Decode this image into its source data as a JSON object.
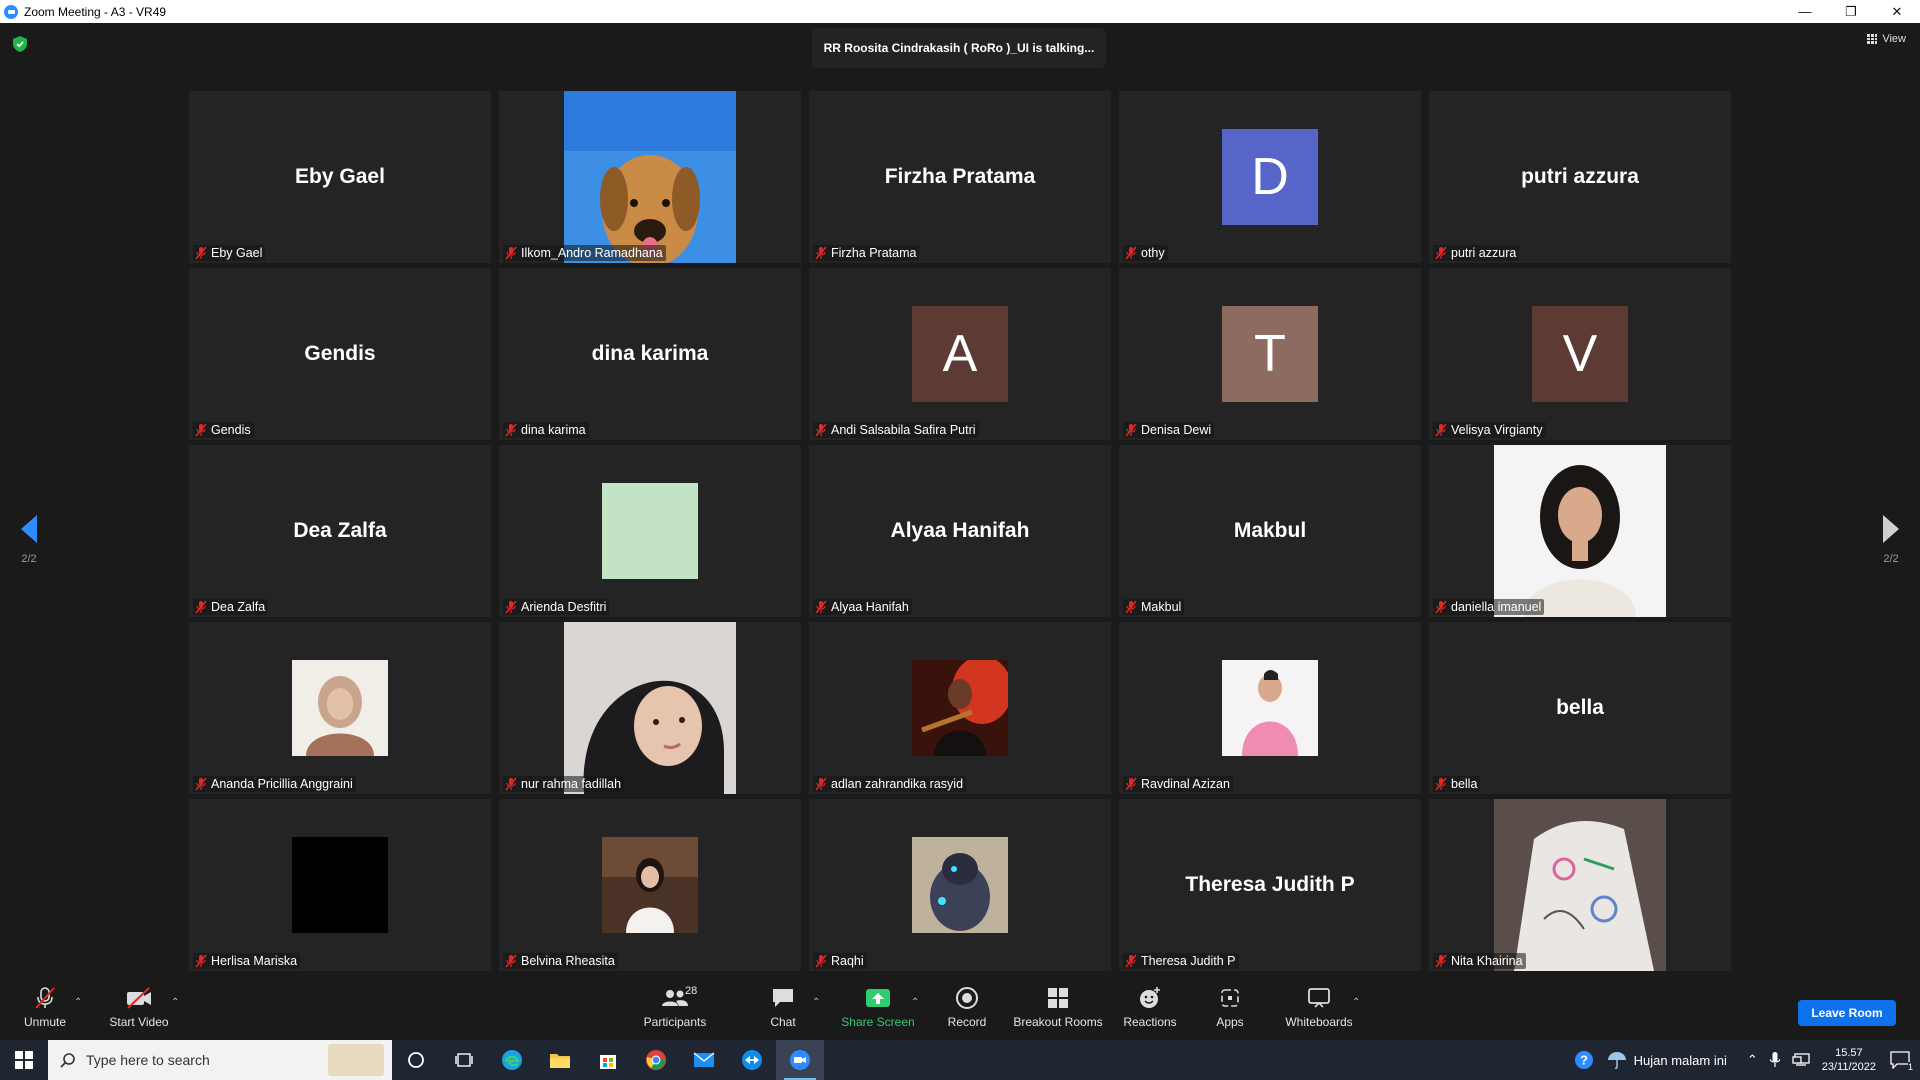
{
  "window": {
    "title": "Zoom Meeting - A3 - VR49",
    "controls": [
      "—",
      "❐",
      "✕"
    ]
  },
  "meeting": {
    "talking_indicator": "RR Roosita Cindrakasih ( RoRo )_UI is talking...",
    "view_label": "View",
    "page_left": "2/2",
    "page_right": "2/2"
  },
  "tiles": [
    {
      "name": "Eby Gael",
      "display": "Eby Gael",
      "type": "name"
    },
    {
      "name": "Ilkom_Andro Ramadhana",
      "type": "photo",
      "photo": "dog-photo"
    },
    {
      "name": "Firzha Pratama",
      "display": "Firzha Pratama",
      "type": "name"
    },
    {
      "name": "othy",
      "type": "avatar",
      "letter": "D",
      "color": "#5865c8"
    },
    {
      "name": "putri azzura",
      "display": "putri azzura",
      "type": "name"
    },
    {
      "name": "Gendis",
      "display": "Gendis",
      "type": "name"
    },
    {
      "name": "dina karima",
      "display": "dina karima",
      "type": "name"
    },
    {
      "name": "Andi Salsabila Safira Putri",
      "type": "avatar",
      "letter": "A",
      "color": "#5c3b34"
    },
    {
      "name": "Denisa Dewi",
      "type": "avatar",
      "letter": "T",
      "color": "#8e6b60"
    },
    {
      "name": "Velisya Virgianty",
      "type": "avatar",
      "letter": "V",
      "color": "#5c3b34"
    },
    {
      "name": "Dea Zalfa",
      "display": "Dea Zalfa",
      "type": "name"
    },
    {
      "name": "Arienda Desfitri",
      "type": "square",
      "color": "#c3e4c4"
    },
    {
      "name": "Alyaa Hanifah",
      "display": "Alyaa Hanifah",
      "type": "name"
    },
    {
      "name": "Makbul",
      "display": "Makbul",
      "type": "name"
    },
    {
      "name": "daniella imanuel",
      "type": "photo",
      "photo": "woman-white-shirt"
    },
    {
      "name": "Ananda Pricillia Anggraini",
      "type": "photo-sq",
      "photo": "woman-hijab-beige"
    },
    {
      "name": "nur rahma fadillah",
      "type": "photo",
      "photo": "woman-black-hijab"
    },
    {
      "name": "adlan zahrandika rasyid",
      "type": "photo-sq",
      "photo": "man-guitar-red"
    },
    {
      "name": "Ravdinal Azizan",
      "type": "photo-sq",
      "photo": "man-pink-shirt"
    },
    {
      "name": "bella",
      "display": "bella",
      "type": "name"
    },
    {
      "name": "Herlisa Mariska",
      "type": "square",
      "color": "#000000"
    },
    {
      "name": "Belvina Rheasita",
      "type": "photo-sq",
      "photo": "girl-room"
    },
    {
      "name": "Raqhi",
      "type": "photo-sq",
      "photo": "character-dark"
    },
    {
      "name": "Theresa Judith P",
      "display": "Theresa Judith P",
      "type": "name"
    },
    {
      "name": "Nita Khairina",
      "type": "photo",
      "photo": "cast-doodle"
    }
  ],
  "toolbar": {
    "unmute": "Unmute",
    "start_video": "Start Video",
    "participants": "Participants",
    "participants_count": "28",
    "chat": "Chat",
    "share_screen": "Share Screen",
    "record": "Record",
    "breakout_rooms": "Breakout Rooms",
    "reactions": "Reactions",
    "apps": "Apps",
    "whiteboards": "Whiteboards",
    "leave_room": "Leave Room"
  },
  "taskbar": {
    "search_placeholder": "Type here to search",
    "weather": "Hujan malam ini",
    "time": "15.57",
    "date": "23/11/2022",
    "notification_count": "1"
  }
}
